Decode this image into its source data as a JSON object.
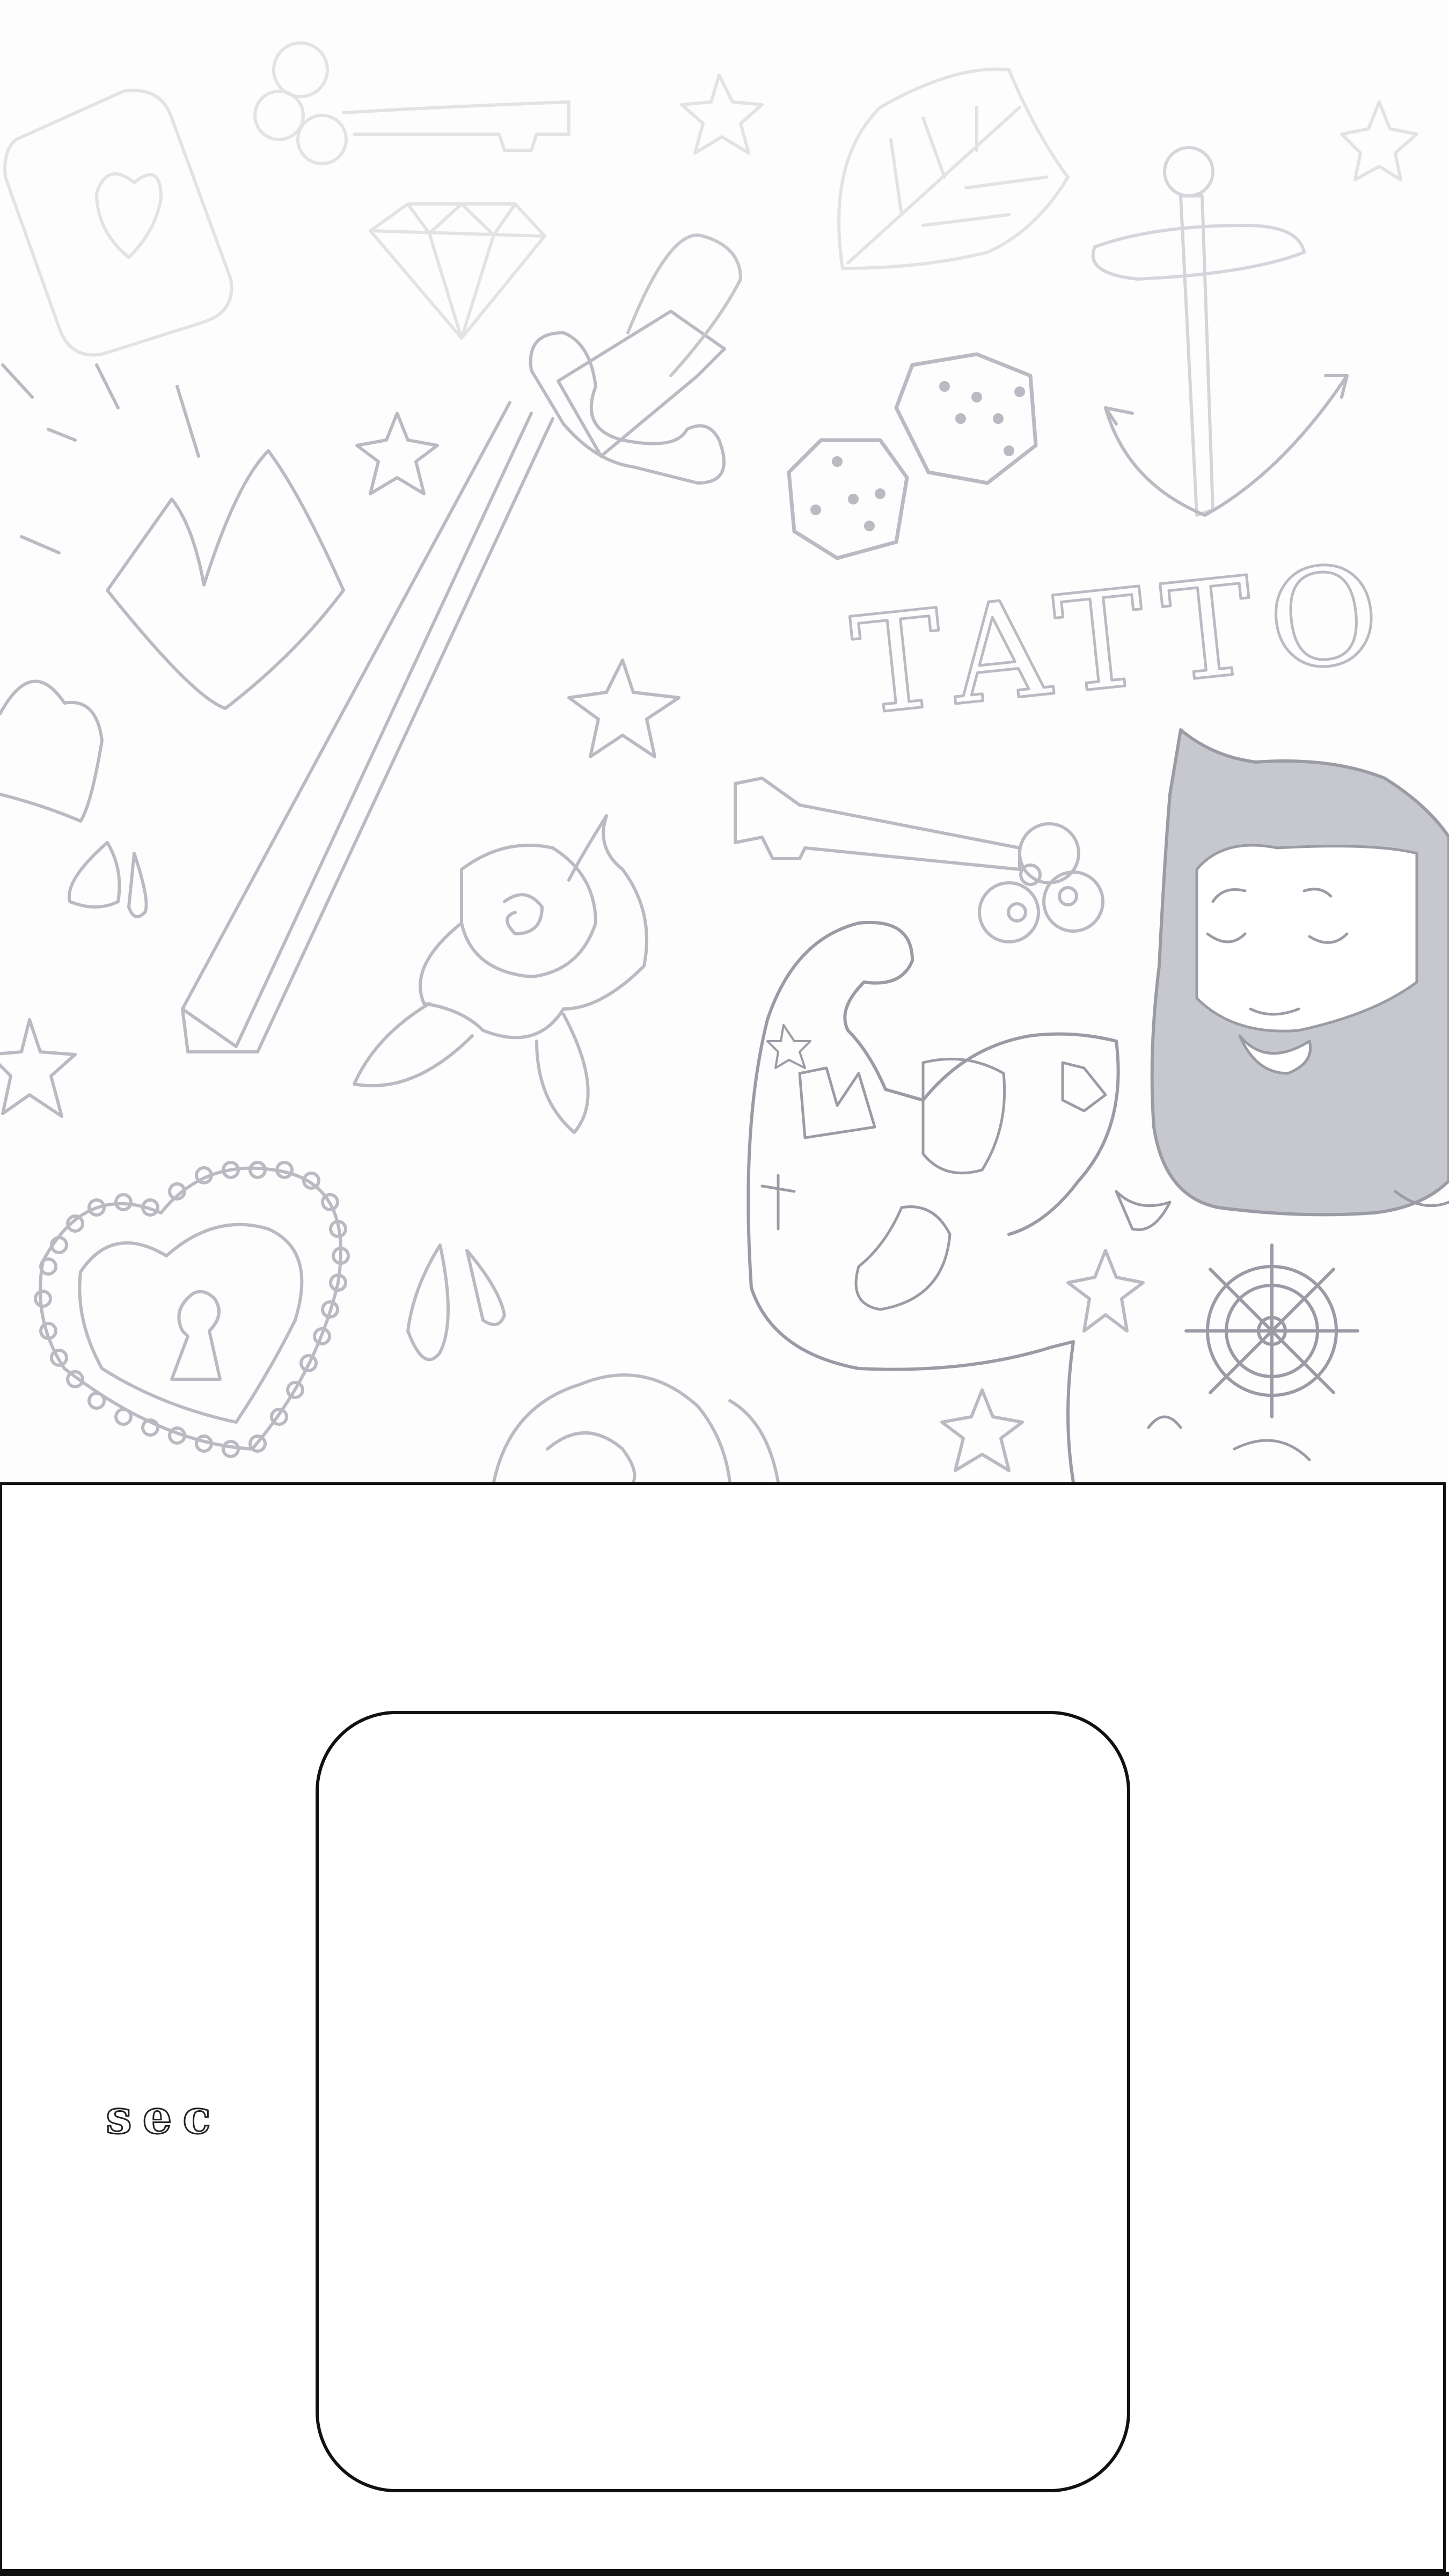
{
  "background": {
    "description_icons": [
      "playing-card-icon",
      "key-icon",
      "star-icon",
      "diamond-icon",
      "leaf-icon",
      "anchor-icon",
      "crown-icon",
      "sword-icon",
      "dice-icon",
      "heart-icon",
      "drop-icon",
      "rose-icon",
      "locket-icon",
      "tattooed-man-icon",
      "ship-wheel-icon"
    ],
    "lettering": "TATTO"
  },
  "timer": {
    "unit_label": "sec",
    "value": ""
  },
  "colors": {
    "doodle_light": "#e2e2e6",
    "doodle_mid": "#b9bac2",
    "doodle_dark": "#9a9ba4",
    "frame": "#111111"
  }
}
